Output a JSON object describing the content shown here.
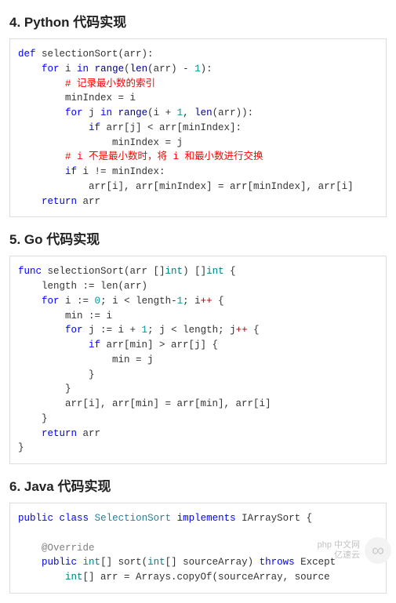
{
  "sections": {
    "python": {
      "title": "4. Python 代码实现"
    },
    "go": {
      "title": "5. Go 代码实现"
    },
    "java": {
      "title": "6. Java 代码实现"
    }
  },
  "code": {
    "python": {
      "l1_def": "def",
      "l1_rest": " selectionSort(arr):",
      "l2_for": "for",
      "l2_in": "in",
      "l2_range": "range",
      "l2_len": "len",
      "l2_a": " i ",
      "l2_b": " ",
      "l2_c": "(",
      "l2_d": "(arr) - ",
      "l2_e": "1",
      "l2_f": "):",
      "l3_comment": "# 记录最小数的索引",
      "l4": "minIndex = i",
      "l5_for": "for",
      "l5_in": "in",
      "l5_range": "range",
      "l5_len": "len",
      "l5_a": " j ",
      "l5_b": " ",
      "l5_c": "(i + ",
      "l5_d": "1",
      "l5_e": ", ",
      "l5_f": "(arr)):",
      "l6_if": "if",
      "l6_a": " arr[j] < arr[minIndex]:",
      "l7": "minIndex = j",
      "l8_comment": "# i 不是最小数时，将 i 和最小数进行交换",
      "l9_if": "if",
      "l9_a": " i != minIndex:",
      "l10": "arr[i], arr[minIndex] = arr[minIndex], arr[i]",
      "l11_ret": "return",
      "l11_a": " arr"
    },
    "go": {
      "l1_func": "func",
      "l1_a": " selectionSort(arr []",
      "l1_int1": "int",
      "l1_b": ") []",
      "l1_int2": "int",
      "l1_c": " {",
      "l2": "    length := len(arr)",
      "l3_for": "for",
      "l3_a": " i := ",
      "l3_zero": "0",
      "l3_b": "; i < length-",
      "l3_one": "1",
      "l3_c": "; i",
      "l3_pp": "++",
      "l3_d": " {",
      "l4": "        min := i",
      "l5_for": "for",
      "l5_a": " j := i + ",
      "l5_one": "1",
      "l5_b": "; j < length; j",
      "l5_pp": "++",
      "l5_c": " {",
      "l6_if": "if",
      "l6_a": " arr[min] > arr[j] {",
      "l7": "                min = j",
      "l8": "            }",
      "l9": "        }",
      "l10": "        arr[i], arr[min] = arr[min], arr[i]",
      "l11": "    }",
      "l12_ret": "return",
      "l12_a": " arr",
      "l13": "}"
    },
    "java": {
      "l1_public": "public",
      "l1_class": "class",
      "l1_name": "SelectionSort",
      "l1_impl": "implements",
      "l1_iface": "IArraySort {",
      "l2_ann": "@Override",
      "l3_public": "public",
      "l3_int1": "int",
      "l3_a": "[] sort(",
      "l3_int2": "int",
      "l3_b": "[] sourceArray) ",
      "l3_throws": "throws",
      "l3_c": " Except",
      "l4_int": "int",
      "l4_a": "[] arr = Arrays.copyOf(sourceArray, source"
    }
  },
  "watermark": {
    "line1": "php 中文网",
    "line2": "亿速云"
  }
}
